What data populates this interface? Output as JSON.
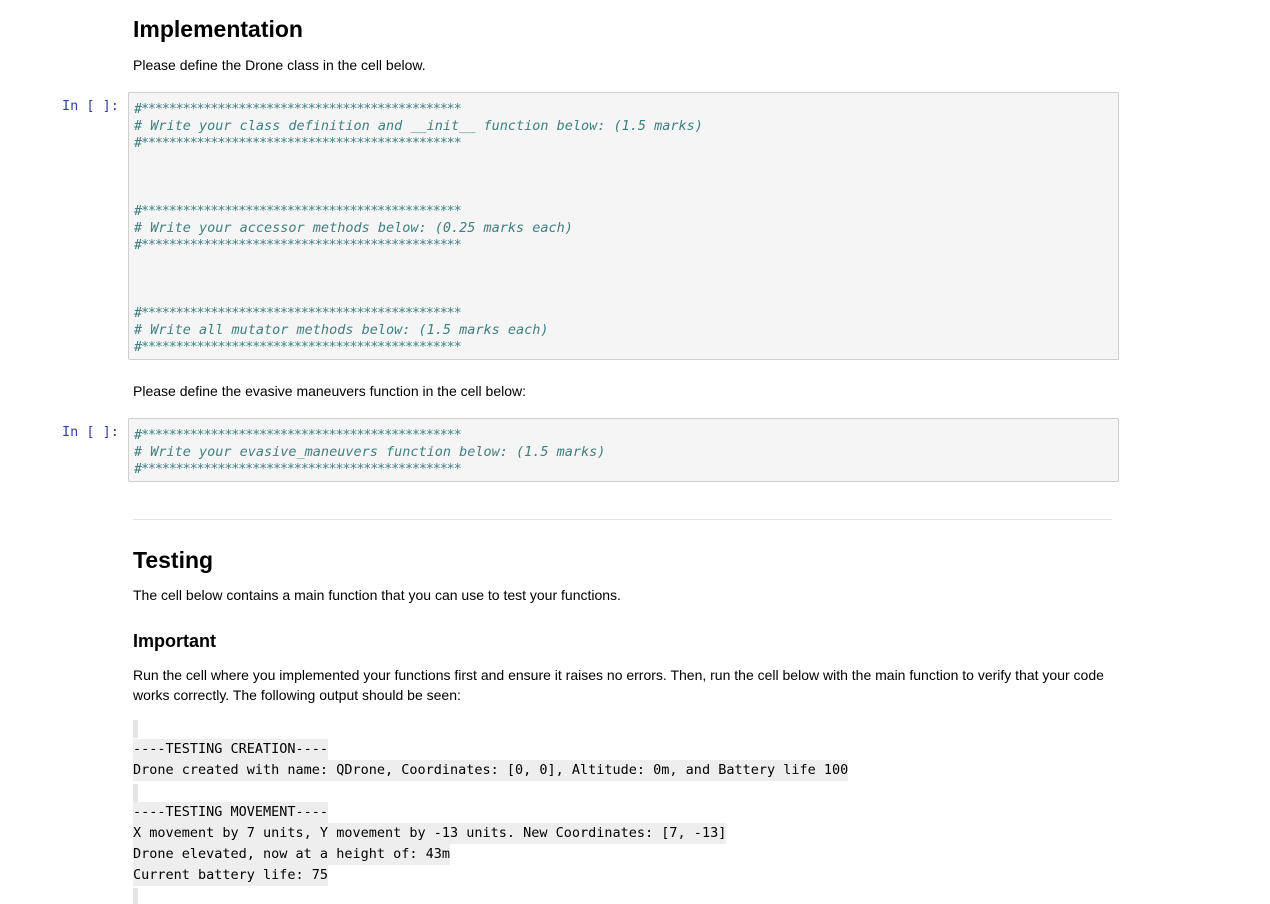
{
  "implementation": {
    "heading": "Implementation",
    "intro": "Please define the Drone class in the cell below."
  },
  "cell1": {
    "prompt": "In [ ]:",
    "stars": "#**********************************************",
    "comment1": "# Write your class definition and __init__ function below: (1.5 marks)",
    "comment2": "# Write your accessor methods below: (0.25 marks each)",
    "comment3": "# Write all mutator methods below: (1.5 marks each)"
  },
  "between": "Please define the evasive maneuvers function in the cell below:",
  "cell2": {
    "prompt": "In [ ]:",
    "stars": "#**********************************************",
    "comment1": "# Write your evasive_maneuvers function below: (1.5 marks)"
  },
  "testing": {
    "heading": "Testing",
    "intro": "The cell below contains a main function that you can use to test your functions.",
    "important_heading": "Important",
    "important_text": "Run the cell where you implemented your functions first and ensure it raises no errors. Then, run the cell below with the main function to verify that your code works correctly. The following output should be seen:"
  },
  "expected_output": {
    "creation_header": "----TESTING CREATION----",
    "creation_line": "Drone created with name: QDrone, Coordinates: [0, 0], Altitude: 0m, and Battery life 100",
    "movement_header": "----TESTING MOVEMENT----",
    "movement_line1": "X movement by 7 units, Y movement by -13 units. New Coordinates: [7, -13]",
    "movement_line2": "Drone elevated, now at a height of: 43m",
    "movement_line3": "Current battery life: 75"
  }
}
